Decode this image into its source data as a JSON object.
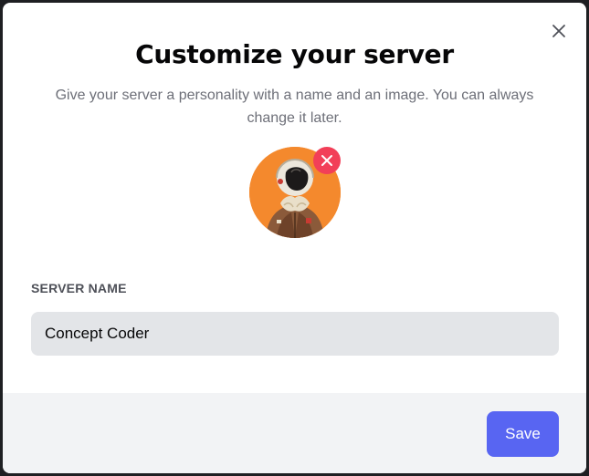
{
  "dialog": {
    "title": "Customize your server",
    "subtitle": "Give your server a personality with a name and an image. You can always change it later.",
    "close_icon": "close-icon",
    "avatar": {
      "remove_icon": "close-icon"
    },
    "server_name": {
      "label": "SERVER NAME",
      "value": "Concept Coder"
    },
    "save_label": "Save"
  },
  "colors": {
    "accent": "#5865f2",
    "remove": "#f23f58",
    "avatar_bg": "#f4892d"
  }
}
